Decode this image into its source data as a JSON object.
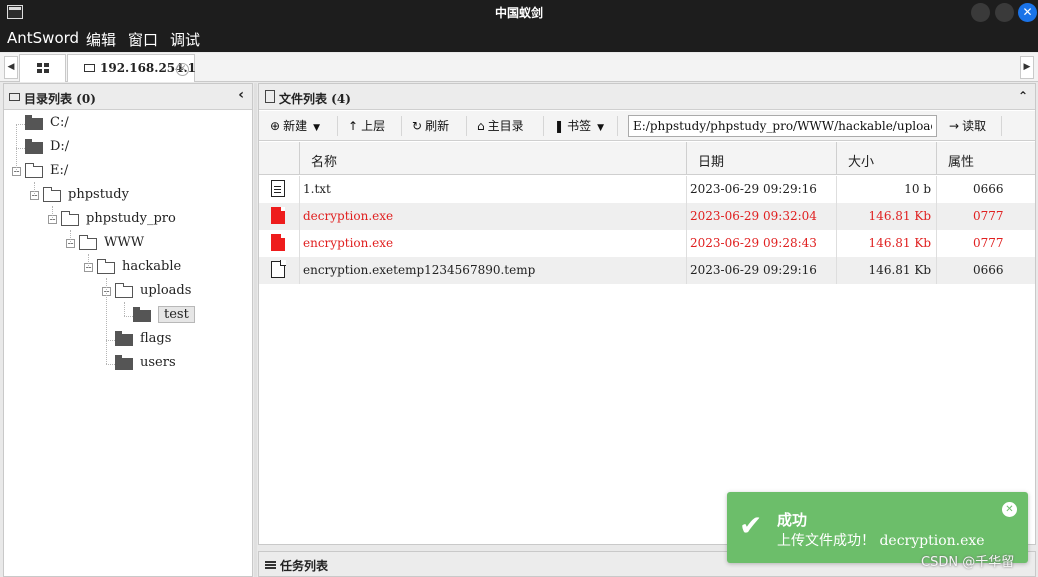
{
  "window": {
    "title": "中国蚁剑"
  },
  "menu": {
    "items": [
      "AntSword",
      "编辑",
      "窗口",
      "调试"
    ]
  },
  "tabs": {
    "connection_label": "192.168.254.1"
  },
  "dir_pane": {
    "title": "目录列表 (0)",
    "tree": [
      {
        "label": "C:/",
        "depth": 0,
        "state": "closed"
      },
      {
        "label": "D:/",
        "depth": 0,
        "state": "closed"
      },
      {
        "label": "E:/",
        "depth": 0,
        "state": "open"
      },
      {
        "label": "phpstudy",
        "depth": 1,
        "state": "open"
      },
      {
        "label": "phpstudy_pro",
        "depth": 2,
        "state": "open"
      },
      {
        "label": "WWW",
        "depth": 3,
        "state": "open"
      },
      {
        "label": "hackable",
        "depth": 4,
        "state": "open"
      },
      {
        "label": "uploads",
        "depth": 5,
        "state": "open"
      },
      {
        "label": "test",
        "depth": 6,
        "state": "closed",
        "selected": true
      },
      {
        "label": "flags",
        "depth": 5,
        "state": "closed"
      },
      {
        "label": "users",
        "depth": 5,
        "state": "closed"
      }
    ]
  },
  "file_pane": {
    "title": "文件列表 (4)",
    "toolbar": {
      "new": "新建",
      "up": "上层",
      "refresh": "刷新",
      "home": "主目录",
      "bookmark": "书签",
      "path": "E:/phpstudy/phpstudy_pro/WWW/hackable/uploads/test/",
      "read": "读取"
    },
    "columns": [
      "名称",
      "日期",
      "大小",
      "属性"
    ],
    "files": [
      {
        "name": "1.txt",
        "date": "2023-06-29 09:29:16",
        "size": "10 b",
        "perm": "0666",
        "icon": "text-file-icon",
        "highlight": false
      },
      {
        "name": "decryption.exe",
        "date": "2023-06-29 09:32:04",
        "size": "146.81 Kb",
        "perm": "0777",
        "icon": "exe-file-icon",
        "highlight": true
      },
      {
        "name": "encryption.exe",
        "date": "2023-06-29 09:28:43",
        "size": "146.81 Kb",
        "perm": "0777",
        "icon": "exe-file-icon",
        "highlight": true
      },
      {
        "name": "encryption.exetemp1234567890.temp",
        "date": "2023-06-29 09:29:16",
        "size": "146.81 Kb",
        "perm": "0666",
        "icon": "blank-file-icon",
        "highlight": false
      }
    ]
  },
  "task_pane": {
    "title": "任务列表"
  },
  "toast": {
    "title": "成功",
    "message": "上传文件成功！",
    "filename": "decryption.exe",
    "color": "#6cbe6a"
  },
  "watermark": "CSDN @千华留"
}
